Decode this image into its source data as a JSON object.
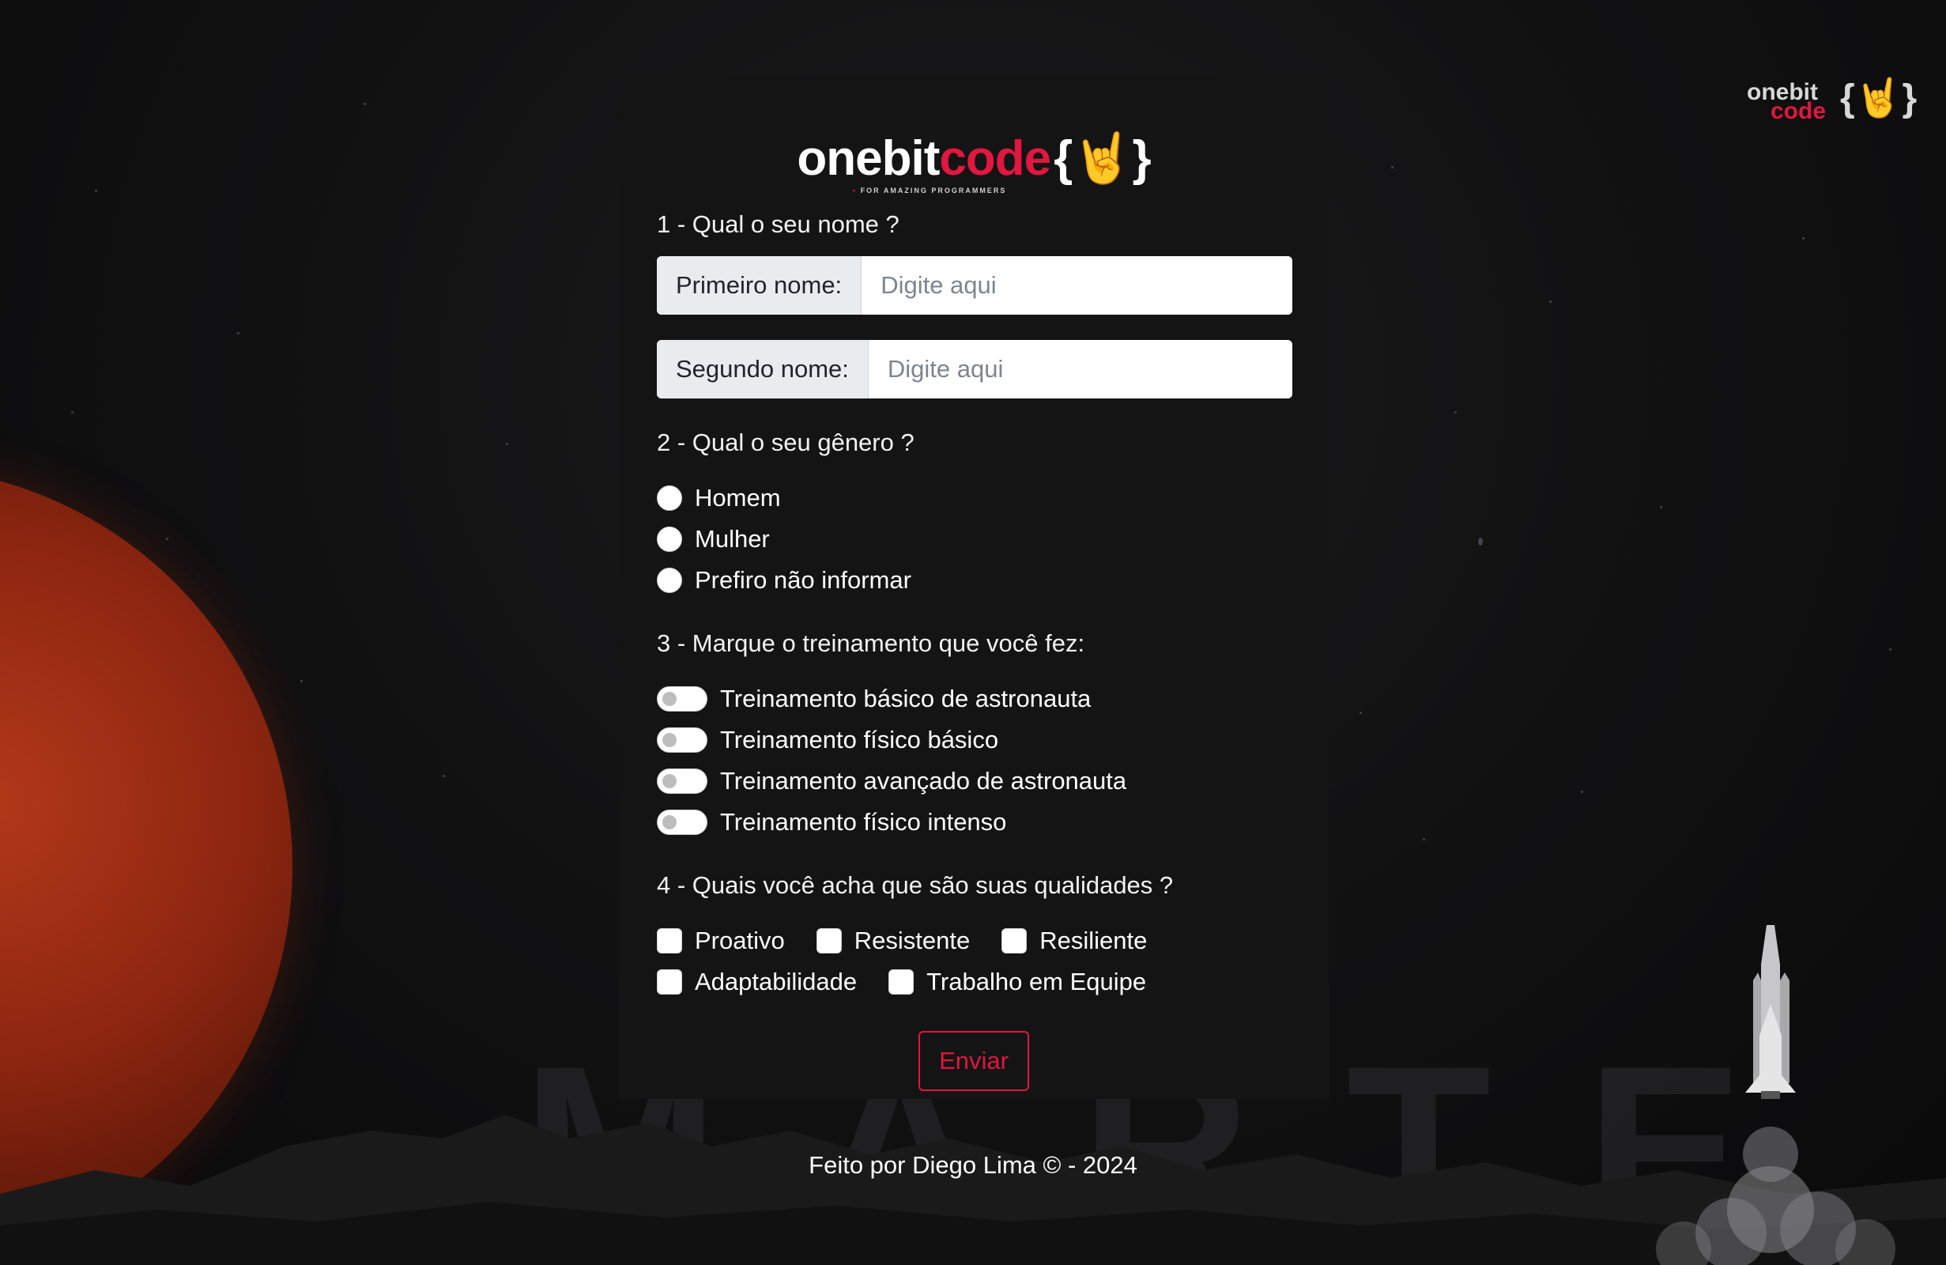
{
  "brand": {
    "word_main": "onebit",
    "word_accent": "code",
    "brace": "{🤘}",
    "tagline": "FOR AMAZING PROGRAMMERS"
  },
  "corner_logo": {
    "line1": "onebit",
    "line2": "code",
    "brace": "{🤘}"
  },
  "background": {
    "watermark": "MARTE"
  },
  "form": {
    "q1": "1 - Qual o seu nome ?",
    "first_name": {
      "label": "Primeiro nome:",
      "placeholder": "Digite aqui",
      "value": ""
    },
    "last_name": {
      "label": "Segundo nome:",
      "placeholder": "Digite aqui",
      "value": ""
    },
    "q2": "2 - Qual o seu gênero ?",
    "genders": [
      "Homem",
      "Mulher",
      "Prefiro não informar"
    ],
    "q3": "3 - Marque o treinamento que você fez:",
    "trainings": [
      "Treinamento básico de astronauta",
      "Treinamento físico básico",
      "Treinamento avançado de astronauta",
      "Treinamento físico intenso"
    ],
    "q4": "4 - Quais você acha que são suas qualidades ?",
    "qualities": [
      "Proativo",
      "Resistente",
      "Resiliente",
      "Adaptabilidade",
      "Trabalho em Equipe"
    ],
    "submit": "Enviar"
  },
  "footer": {
    "text": "Feito por Diego Lima © - 2024"
  },
  "colors": {
    "accent": "#e0173e",
    "card": "#141415",
    "page": "#0b0b0c",
    "planet": "#8d2610"
  }
}
